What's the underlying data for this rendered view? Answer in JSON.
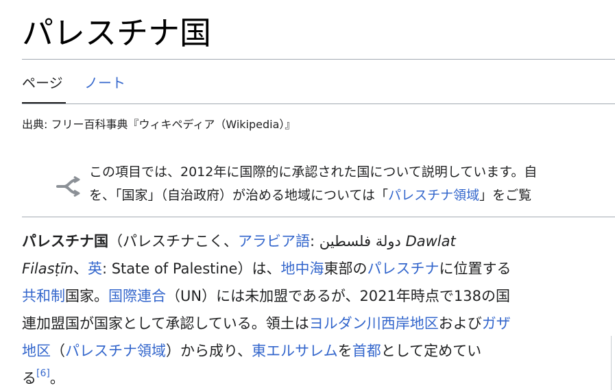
{
  "title": "パレスチナ国",
  "tabs": {
    "page": "ページ",
    "talk": "ノート"
  },
  "source": "出典: フリー百科事典『ウィキペディア（Wikipedia）』",
  "hatnote": {
    "icon": "disambiguation-arrow-icon",
    "line1": "この項目では、2012年に国際的に承認された国について説明しています。自",
    "line2_before": "を、「国家」（自治政府）が治める地域については「",
    "line2_link": "パレスチナ領域",
    "line2_after": "」をご覧"
  },
  "lead": {
    "l1_bold": "パレスチナ国",
    "l1_t1": "（パレスチナこく、",
    "l1_link_arabic": "アラビア語",
    "l1_t2": ": ",
    "l1_arabic": "دولة فلسطين",
    "l1_t3": " ",
    "l1_italic": "Dawlat",
    "l2_italic": "Filasṭīn",
    "l2_t1": "、",
    "l2_link_en": "英",
    "l2_t2": ": State of Palestine）は、",
    "l2_link_med": "地中海",
    "l2_t3": "東部の",
    "l2_link_pal": "パレスチナ",
    "l2_t4": "に位置する",
    "l3_link_rep": "共和制",
    "l3_t1": "国家。",
    "l3_link_un": "国際連合",
    "l3_t2": "（UN）には未加盟であるが、2021年時点で138の国",
    "l4_t1": "連加盟国が国家として承認している。領土は",
    "l4_link_wb": "ヨルダン川西岸地区",
    "l4_t2": "および",
    "l4_link_gaza": "ガザ",
    "l5_link_gaza2": "地区",
    "l5_t1": "（",
    "l5_link_terr": "パレスチナ領域",
    "l5_t2": "）から成り、",
    "l5_link_ej": "東エルサレム",
    "l5_t3": "を",
    "l5_link_cap": "首都",
    "l5_t4": "として定めてい",
    "l6_t1": "る",
    "l6_ref": "[6]",
    "l6_t2": "。"
  }
}
